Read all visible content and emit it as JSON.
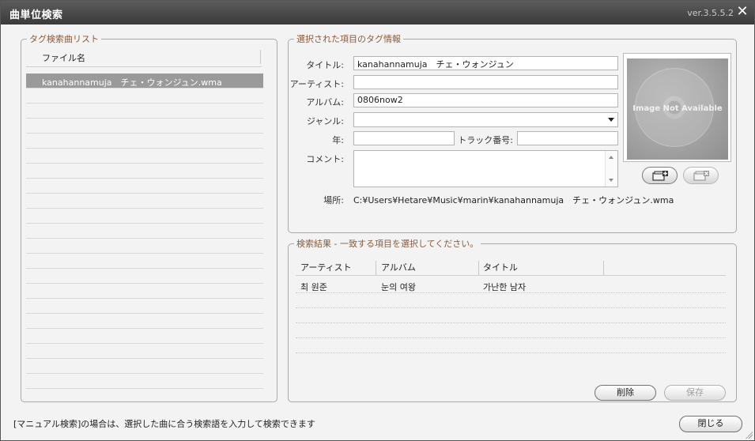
{
  "window": {
    "title": "曲単位検索",
    "version": "ver.3.5.5.2"
  },
  "tag_list": {
    "legend": "タグ検索曲リスト",
    "column_header": "ファイル名",
    "items": [
      "kanahannamuja　チェ・ウォンジュン.wma"
    ]
  },
  "tag_info": {
    "legend": "選択された項目のタグ情報",
    "title_label": "タイトル:",
    "title_value": "kanahannamuja　チェ・ウォンジュン",
    "artist_label": "アーティスト:",
    "artist_value": "",
    "album_label": "アルバム:",
    "album_value": "0806now2",
    "genre_label": "ジャンル:",
    "genre_value": "",
    "year_label": "年:",
    "year_value": "",
    "track_label": "トラック番号:",
    "track_value": "",
    "comment_label": "コメント:",
    "comment_value": "",
    "location_label": "場所:",
    "location_value": "C:¥Users¥Hetare¥Music¥marin¥kanahannamuja　チェ・ウォンジュン.wma",
    "cover_text": "Image Not Available",
    "add_cover_icon": "add-image-icon",
    "remove_cover_icon": "remove-image-icon"
  },
  "results": {
    "legend": "検索結果 - 一致する項目を選択してください。",
    "columns": [
      "アーティスト",
      "アルバム",
      "タイトル"
    ],
    "rows": [
      {
        "artist": "최 원준",
        "album": "눈의 여왕",
        "title": "가난한 남자"
      }
    ],
    "delete_label": "削除",
    "save_label": "保存"
  },
  "status_text": "[マニュアル検索]の場合は、選択した曲に合う検索語を入力して検索できます",
  "close_label": "閉じる",
  "colors": {
    "titlebar": "#4a4a4a",
    "legend": "#8a5a3a",
    "selection": "#9a9a9a"
  }
}
